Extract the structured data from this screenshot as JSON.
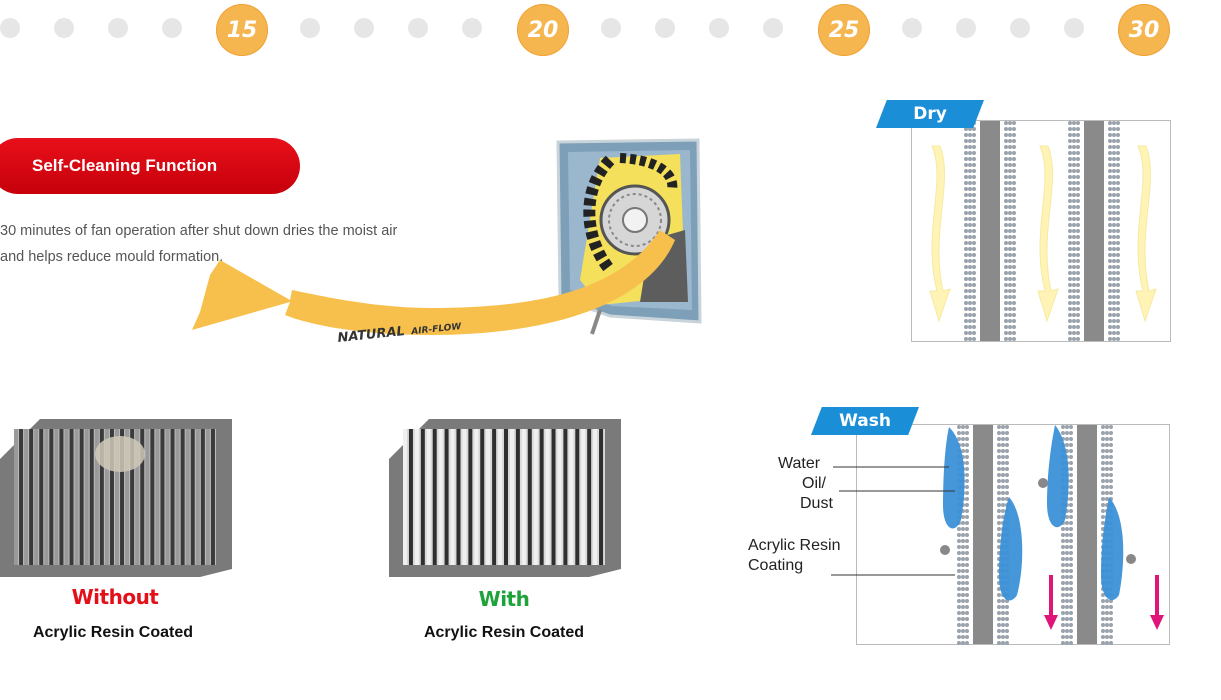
{
  "timeline": {
    "badges": [
      "15",
      "20",
      "25",
      "30"
    ]
  },
  "feature": {
    "title": "Self-Cleaning Function",
    "description_line1": "30 minutes of fan operation after shut down dries the moist air",
    "description_line2": "and helps reduce mould formation."
  },
  "airflow": {
    "label_big": "NATURAL",
    "label_small": "AIR-FLOW"
  },
  "comparison": {
    "without_label": "Without",
    "without_sub": "Acrylic Resin Coated",
    "with_label": "With",
    "with_sub": "Acrylic Resin Coated"
  },
  "dry_panel": {
    "tab": "Dry"
  },
  "wash_panel": {
    "tab": "Wash",
    "legend_water": "Water",
    "legend_oil": "Oil/",
    "legend_dust": "Dust",
    "legend_acrylic": "Acrylic Resin",
    "legend_coating": "Coating"
  },
  "colors": {
    "accent_red": "#e3101a",
    "badge_orange": "#f5b54f",
    "tab_blue": "#1a8fd8",
    "without_red": "#e3101a",
    "with_green": "#1ea23a",
    "water_blue": "#3c92d8",
    "arrow_magenta": "#e0157a",
    "airflow_yellow": "#f7c04d"
  }
}
